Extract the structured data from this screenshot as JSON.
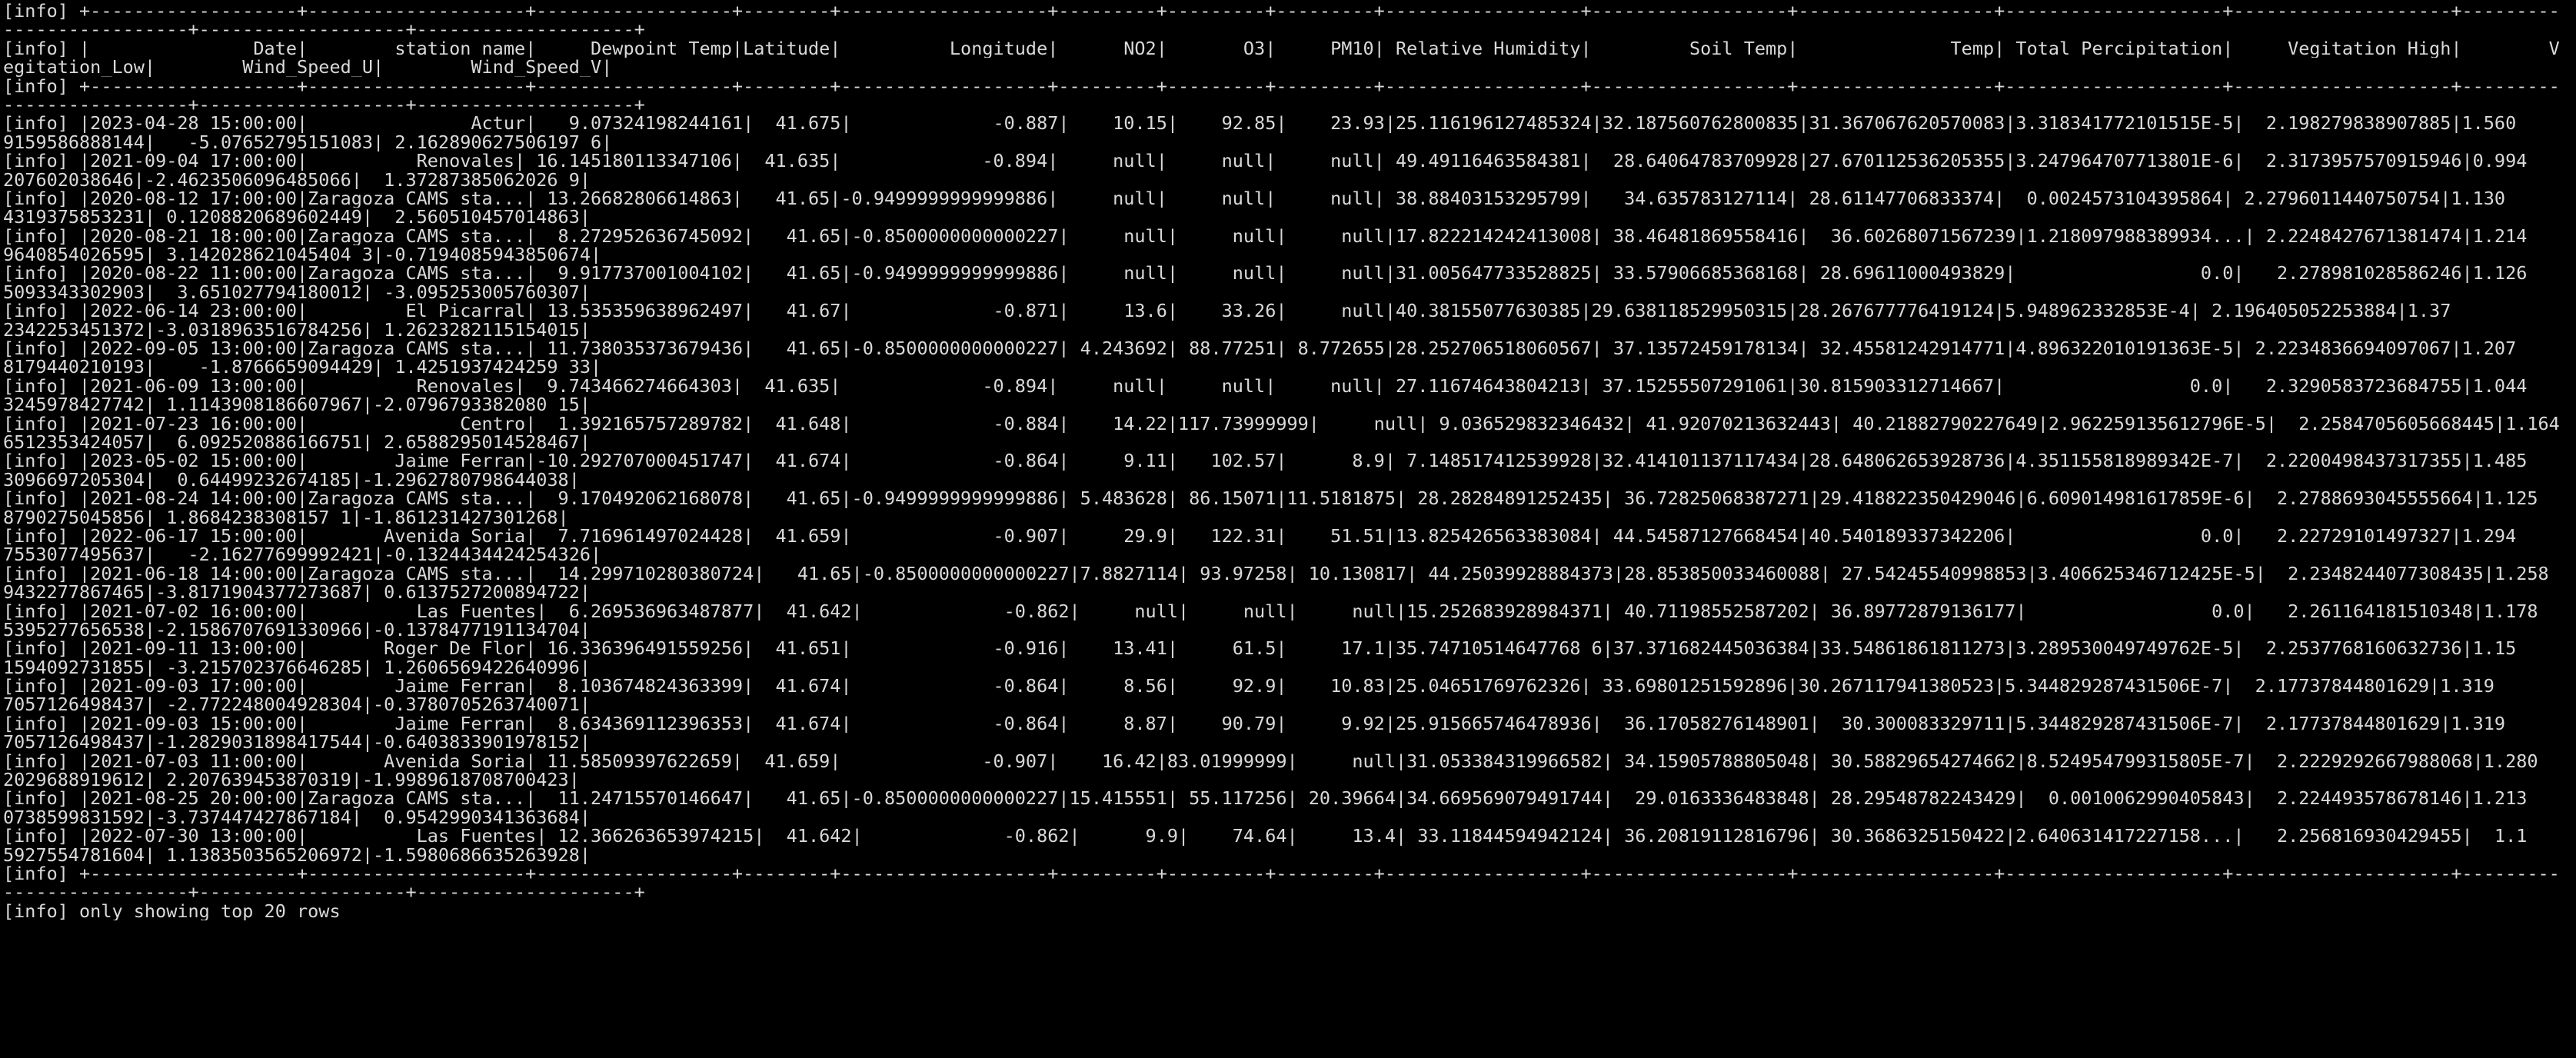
{
  "terminal": {
    "lines": [
      "[info] +-------------------+--------------------+------------------+--------+-------------------+---------+---------+---------+------------------+------------------+------------------+--------------------+--------------------+---------",
      "-----------------+-------------------+--------------------+",
      "[info] |               Date|        station_name|     Dewpoint_Temp|Latitude|          Longitude|      NO2|       O3|     PM10| Relative_Humidity|         Soil_Temp|              Temp| Total_Percipitation|     Vegitation_High|        V",
      "egitation_Low|        Wind_Speed_U|        Wind_Speed_V|",
      "[info] +-------------------+--------------------+------------------+--------+-------------------+---------+---------+---------+------------------+------------------+------------------+--------------------+--------------------+---------",
      "-----------------+-------------------+--------------------+",
      "[info] |2023-04-28 15:00:00|               Actur|   9.07324198244161|  41.675|             -0.887|    10.15|    92.85|    23.93|25.116196127485324|32.187560762800835|31.367067620570083|3.318341772101515E-5|  2.198279838907885|1.560",
      "9159586888144|   -5.07652795151083| 2.162890627506197 6|",
      "[info] |2021-09-04 17:00:00|          Renovales| 16.145180113347106|  41.635|             -0.894|     null|     null|     null| 49.49116463584381|  28.64064783709928|27.670112536205355|3.247964707713801E-6|  2.3173957570915946|0.994",
      "207602038646|-2.4623506096485066|  1.37287385062026 9|",
      "[info] |2020-08-12 17:00:00|Zaragoza CAMS sta...| 13.26682806614863|   41.65|-0.9499999999999886|     null|     null|     null| 38.88403153295799|   34.635783127114| 28.61147706833374|  0.0024573104395864| 2.2796011440750754|1.130",
      "4319375853231| 0.1208820689602449|  2.560510457014863|",
      "[info] |2020-08-21 18:00:00|Zaragoza CAMS sta...|  8.272952636745092|   41.65|-0.8500000000000227|     null|     null|     null|17.822214242413008| 38.46481869558416|  36.60268071567239|1.218097988389934...| 2.2248427671381474|1.214",
      "9640854026595| 3.142028621045404 3|-0.7194085943850674|",
      "[info] |2020-08-22 11:00:00|Zaragoza CAMS sta...|  9.917737001004102|   41.65|-0.9499999999999886|     null|     null|     null|31.005647733528825| 33.57906685368168| 28.69611000493829|                 0.0|   2.278981028586246|1.126",
      "5093343302903|  3.651027794180012| -3.095253005760307|",
      "[info] |2022-06-14 23:00:00|         El Picarral| 13.535359638962497|   41.67|             -0.871|     13.6|    33.26|     null|40.38155077630385|29.638118529950315|28.267677776419124|5.948962332853E-4| 2.196405052253884|1.37",
      "2342253451372|-3.0318963516784256| 1.2623282115154015|",
      "[info] |2022-09-05 13:00:00|Zaragoza CAMS sta...| 11.738035373679436|   41.65|-0.8500000000000227| 4.243692| 88.77251| 8.772655|28.252706518060567| 37.13572459178134| 32.45581242914771|4.896322010191363E-5| 2.2234836694097067|1.207",
      "8179440210193|    -1.8766659094429| 1.4251937424259 33|",
      "[info] |2021-06-09 13:00:00|          Renovales|  9.743466274664303|  41.635|             -0.894|     null|     null|     null| 27.11674643804213| 37.15255507291061|30.815903312714667|                 0.0|   2.3290583723684755|1.044",
      "3245978427742| 1.1143908186607967|-2.0796793382080 15|",
      "[info] |2021-07-23 16:00:00|              Centro|  1.392165757289782|  41.648|             -0.884|    14.22|117.73999999|     null| 9.036529832346432| 41.92070213632443| 40.21882790227649|2.962259135612796E-5|  2.2584705605668445|1.164",
      "6512353424057|  6.092520886166751| 2.6588295014528467|",
      "[info] |2023-05-02 15:00:00|        Jaime Ferran|-10.292707000451747|  41.674|             -0.864|     9.11|   102.57|      8.9| 7.148517412539928|32.414101137117434|28.648062653928736|4.351155818989342E-7|  2.2200498437317355|1.485",
      "3096697205304|  0.64499232674185|-1.2962780798644038|",
      "[info] |2021-08-24 14:00:00|Zaragoza CAMS sta...|  9.170492062168078|   41.65|-0.9499999999999886| 5.483628| 86.15071|11.5181875| 28.28284891252435| 36.72825068387271|29.418822350429046|6.609014981617859E-6|  2.2788693045555664|1.125",
      "8790275045856| 1.8684238308157 1|-1.861231427301268|",
      "[info] |2022-06-17 15:00:00|       Avenida Soria|  7.716961497024428|  41.659|             -0.907|     29.9|   122.31|    51.51|13.825426563383084| 44.54587127668454|40.540189337342206|                 0.0|   2.22729101497327|1.294",
      "7553077495637|   -2.16277699992421|-0.1324434424254326|",
      "[info] |2021-06-18 14:00:00|Zaragoza CAMS sta...|  14.299710280380724|   41.65|-0.8500000000000227|7.8827114| 93.97258| 10.130817| 44.25039928884373|28.853850033460088| 27.54245540998853|3.406625346712425E-5|  2.2348244077308435|1.258",
      "9432277867465|-3.8171904377273687| 0.6137527200894722|",
      "[info] |2021-07-02 16:00:00|          Las Fuentes|  6.269536963487877|  41.642|             -0.862|     null|     null|     null|15.252683928984371| 40.71198552587202| 36.89772879136177|                 0.0|   2.261164181510348|1.178",
      "5395277656538|-2.1586707691330966|-0.1378477191134704|",
      "[info] |2021-09-11 13:00:00|       Roger De Flor| 16.336396491559256|  41.651|             -0.916|    13.41|     61.5|     17.1|35.74710514647768 6|37.371682445036384|33.54861861811273|3.289530049749762E-5|  2.2537768160632736|1.15",
      "1594092731855| -3.215702376646285| 1.2606569422640996|",
      "[info] |2021-09-03 17:00:00|        Jaime Ferran|  8.103674824363399|  41.674|             -0.864|     8.56|     92.9|    10.83|25.04651769762326| 33.69801251592896|30.267117941380523|5.344829287431506E-7|  2.17737844801629|1.319",
      "7057126498437| -2.772248004928304|-0.3780705263740071|",
      "[info] |2021-09-03 15:00:00|        Jaime Ferran|  8.634369112396353|  41.674|             -0.864|     8.87|    90.79|     9.92|25.915665746478936|  36.17058276148901|  30.300083329711|5.344829287431506E-7|  2.17737844801629|1.319",
      "7057126498437|-1.2829031898417544|-0.6403833901978152|",
      "[info] |2021-07-03 11:00:00|       Avenida Soria| 11.58509397622659|  41.659|             -0.907|    16.42|83.01999999|     null|31.053384319966582| 34.15905788805048| 30.58829654274662|8.524954799315805E-7|  2.2229292667988068|1.280",
      "2029688919612| 2.207639453870319|-1.9989618708700423|",
      "[info] |2021-08-25 20:00:00|Zaragoza CAMS sta...|  11.24715570146647|   41.65|-0.8500000000000227|15.415551| 55.117256| 20.39664|34.669569079491744|  29.0163336483848| 28.29548782243429|  0.0010062990405843|  2.224493578678146|1.213",
      "0738599831592|-3.737447427867184|  0.9542990341363684|",
      "[info] |2022-07-30 13:00:00|          Las Fuentes| 12.366263653974215|  41.642|             -0.862|      9.9|    74.64|     13.4| 33.11844594942124| 36.20819112816796| 30.3686325150422|2.640631417227158...|   2.256816930429455|  1.1",
      "5927554781604| 1.1383503565206972|-1.5980686635263928|",
      "[info] +-------------------+--------------------+------------------+--------+-------------------+---------+---------+---------+------------------+------------------+------------------+--------------------+--------------------+---------",
      "-----------------+-------------------+--------------------+",
      "[info] only showing top 20 rows"
    ]
  }
}
